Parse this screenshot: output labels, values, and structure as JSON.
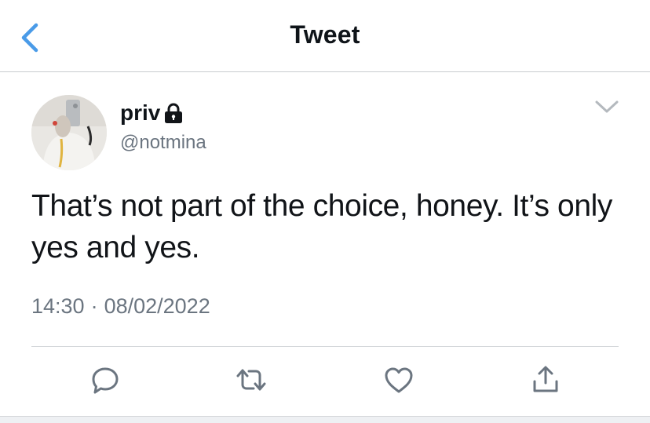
{
  "header": {
    "title": "Tweet",
    "back_icon": "chevron-left-icon",
    "accent_color": "#4a9be8"
  },
  "tweet": {
    "author": {
      "name": "priv",
      "protected_icon": "lock-icon",
      "handle": "@notmina"
    },
    "text": "That’s not part of the choice, honey. It’s only yes and yes.",
    "time": "14:30",
    "separator": "·",
    "date": "08/02/2022",
    "more_icon": "chevron-down-icon"
  },
  "actions": [
    {
      "icon": "reply-icon"
    },
    {
      "icon": "retweet-icon"
    },
    {
      "icon": "like-icon"
    },
    {
      "icon": "share-icon"
    }
  ]
}
